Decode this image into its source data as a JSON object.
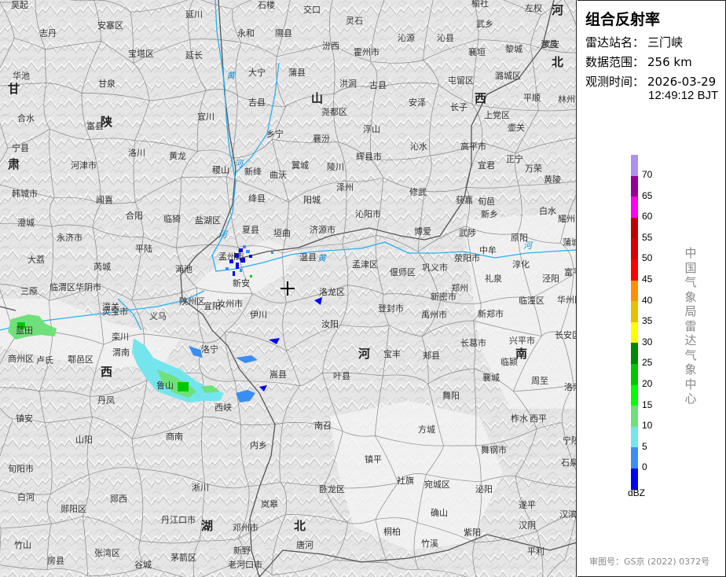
{
  "panel": {
    "title": "组合反射率",
    "station_label": "雷达站名：",
    "station_value": "三门峡",
    "range_label": "数据范围：",
    "range_value": "256 km",
    "time_label": "观测时间：",
    "time_date": "2026-03-29",
    "time_clock": "12:49:12 BJT",
    "legend_unit": "dBZ",
    "legend_ticks": [
      "70",
      "65",
      "60",
      "55",
      "50",
      "45",
      "40",
      "35",
      "30",
      "25",
      "20",
      "15",
      "10",
      "5",
      "0"
    ],
    "legend_colors": [
      "#ad90f0",
      "#960096",
      "#ff00f0",
      "#c10000",
      "#d60000",
      "#ff0000",
      "#ff9000",
      "#e7c000",
      "#ffff00",
      "#008800",
      "#00c800",
      "#00ff00",
      "#70e07a",
      "#74e5ed",
      "#3a8ef0",
      "#0000f6"
    ],
    "agency_vertical": "中国气象局雷达气象中心",
    "approval": "审图号：GS京 (2022) 0372号"
  },
  "map": {
    "background": "#e9e9e9",
    "river_color": "#2ab0ef",
    "station_marker": "crosshair-icon",
    "place_names": [
      "吴起",
      "延川",
      "石楼",
      "交口",
      "灵石",
      "榆社",
      "左权",
      "志丹",
      "安塞区",
      "永和",
      "隰县",
      "汾西",
      "沁源",
      "沁县",
      "武乡",
      "武安",
      "宝塔区",
      "延长",
      "霍州市",
      "襄垣",
      "黎城",
      "涉县",
      "华池",
      "甘泉",
      "大宁",
      "蒲县",
      "洪洞",
      "古县",
      "屯留区",
      "潞城区",
      "合水",
      "吉县",
      "安泽",
      "长子",
      "平顺",
      "林州市",
      "富县",
      "宜川",
      "尧都区",
      "浮山",
      "上党区",
      "壶关",
      "宁县",
      "洛川",
      "黄龙",
      "乡宁",
      "襄汾",
      "沁水",
      "高平市",
      "正宁",
      "黄陵",
      "韩城市",
      "河津市",
      "稷山",
      "新绛",
      "曲沃",
      "翼城",
      "陵川",
      "辉县市",
      "宜君",
      "万荣",
      "闻喜",
      "绛县",
      "阳城",
      "泽州",
      "修武",
      "获嘉",
      "旬邑",
      "白水",
      "澄城",
      "合阳",
      "临猗",
      "盐湖区",
      "夏县",
      "垣曲",
      "济源市",
      "沁阳市",
      "博爱",
      "武陟",
      "新乡",
      "原阳",
      "耀州区",
      "蒲城",
      "永济市",
      "平陆",
      "孟州市",
      "温县",
      "荥阳市",
      "中牟",
      "淳化",
      "富平",
      "大荔",
      "芮城",
      "渑池",
      "新安",
      "孟津区",
      "偃师区",
      "巩义市",
      "郑州",
      "礼泉",
      "泾阳",
      "三原",
      "临渭区",
      "华阴市",
      "潼关",
      "陕州区",
      "宜阳",
      "洛龙区",
      "登封市",
      "新密市",
      "新郑市",
      "临潼区",
      "华州区",
      "灵宝市",
      "义马",
      "伊川",
      "汝州市",
      "禹州市",
      "长葛市",
      "兴平市",
      "长安区",
      "蓝田",
      "鄠邑区",
      "渭南",
      "卢氏",
      "洛宁",
      "嵩县",
      "汝阳",
      "宝丰",
      "郏县",
      "襄城",
      "临颍",
      "周至",
      "洛南",
      "商州区",
      "栾川",
      "鲁山",
      "叶县",
      "舞阳",
      "柞水",
      "丹凤",
      "西峡",
      "南召",
      "方城",
      "舞钢市",
      "西平",
      "宁陕",
      "镇安",
      "山阳",
      "商南",
      "内乡",
      "镇平",
      "社旗",
      "泌阳",
      "遂平",
      "石泉",
      "旬阳市",
      "郧西",
      "淅川",
      "卧龙区",
      "宛城区",
      "确山",
      "汉阴",
      "汉滨区",
      "白河",
      "郧阳区",
      "丹江口市",
      "邓州市",
      "唐河",
      "桐柏",
      "紫阳",
      "平利",
      "竹山",
      "张湾区",
      "茅箭区",
      "新野",
      "岚皋",
      "竹溪",
      "房县",
      "谷城",
      "老河口市"
    ],
    "province_names": [
      "陕",
      "西",
      "山",
      "西",
      "河",
      "南",
      "甘",
      "肃",
      "湖",
      "北",
      "河",
      "北"
    ],
    "river_names": [
      "黄",
      "河",
      "河",
      "黄",
      "河"
    ]
  }
}
